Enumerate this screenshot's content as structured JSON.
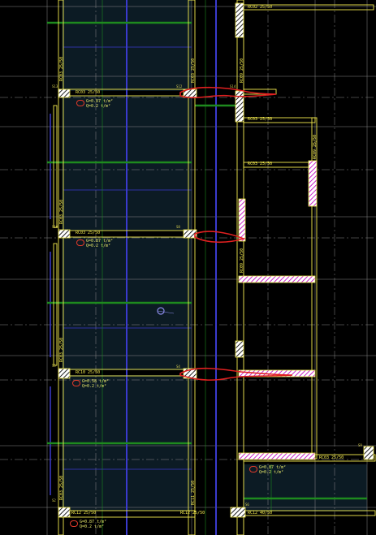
{
  "canvas": {
    "background": "#000000",
    "grid": "#9a9a9a",
    "panel_fill": "#0c1b24",
    "beam": "#f2e94e",
    "rebar_green": "#1e8a1e",
    "axis_blue": "#3a3acc",
    "column_hatch": "#c828c8",
    "load_red": "#e02020"
  },
  "beams_h": {
    "b1_label": "RC02 25/50",
    "b2_label": "RC03 25/50",
    "b3_label": "RC03 25/50",
    "b4_label": "RC03 25/50",
    "b5_label": "RC03 25/50",
    "b6_label": "RC10 25/50",
    "b7_label": "RC03 25/50",
    "b8_label": "RC12 25/50",
    "b9_label": "RC12 25/50",
    "b10_label": "RC12 40/50"
  },
  "beams_v": {
    "v1": "RC03 25/50",
    "v2": "RC03 25/50",
    "v3": "RC03 25/50",
    "v4": "RC03 25/50",
    "v5": "RC03 25/50",
    "v6": "RC09 25/50",
    "v7": "RC09 25/50",
    "v8": "RC09 25/50",
    "v9": "RC11 25/50"
  },
  "loads": [
    {
      "g": "G=0.87 t/m²",
      "q": "Q=0.2 t/m²"
    },
    {
      "g": "G=0.87 t/m²",
      "q": "Q=0.2 t/m²"
    },
    {
      "g": "G=0.58 t/m²",
      "q": "Q=0.2 t/m²"
    },
    {
      "g": "G=0.87 t/m²",
      "q": "Q=0.2 t/m²"
    },
    {
      "g": "G=0.87 t/m²",
      "q": "Q=0.2 t/m²"
    }
  ],
  "nodes": {
    "n1": "S13",
    "n2": "S12",
    "n3": "S10",
    "n4": "S8",
    "n5": "S5",
    "n6": "S4",
    "n7": "S2",
    "n8": "S14",
    "n9": "S9",
    "n10": "S6"
  }
}
